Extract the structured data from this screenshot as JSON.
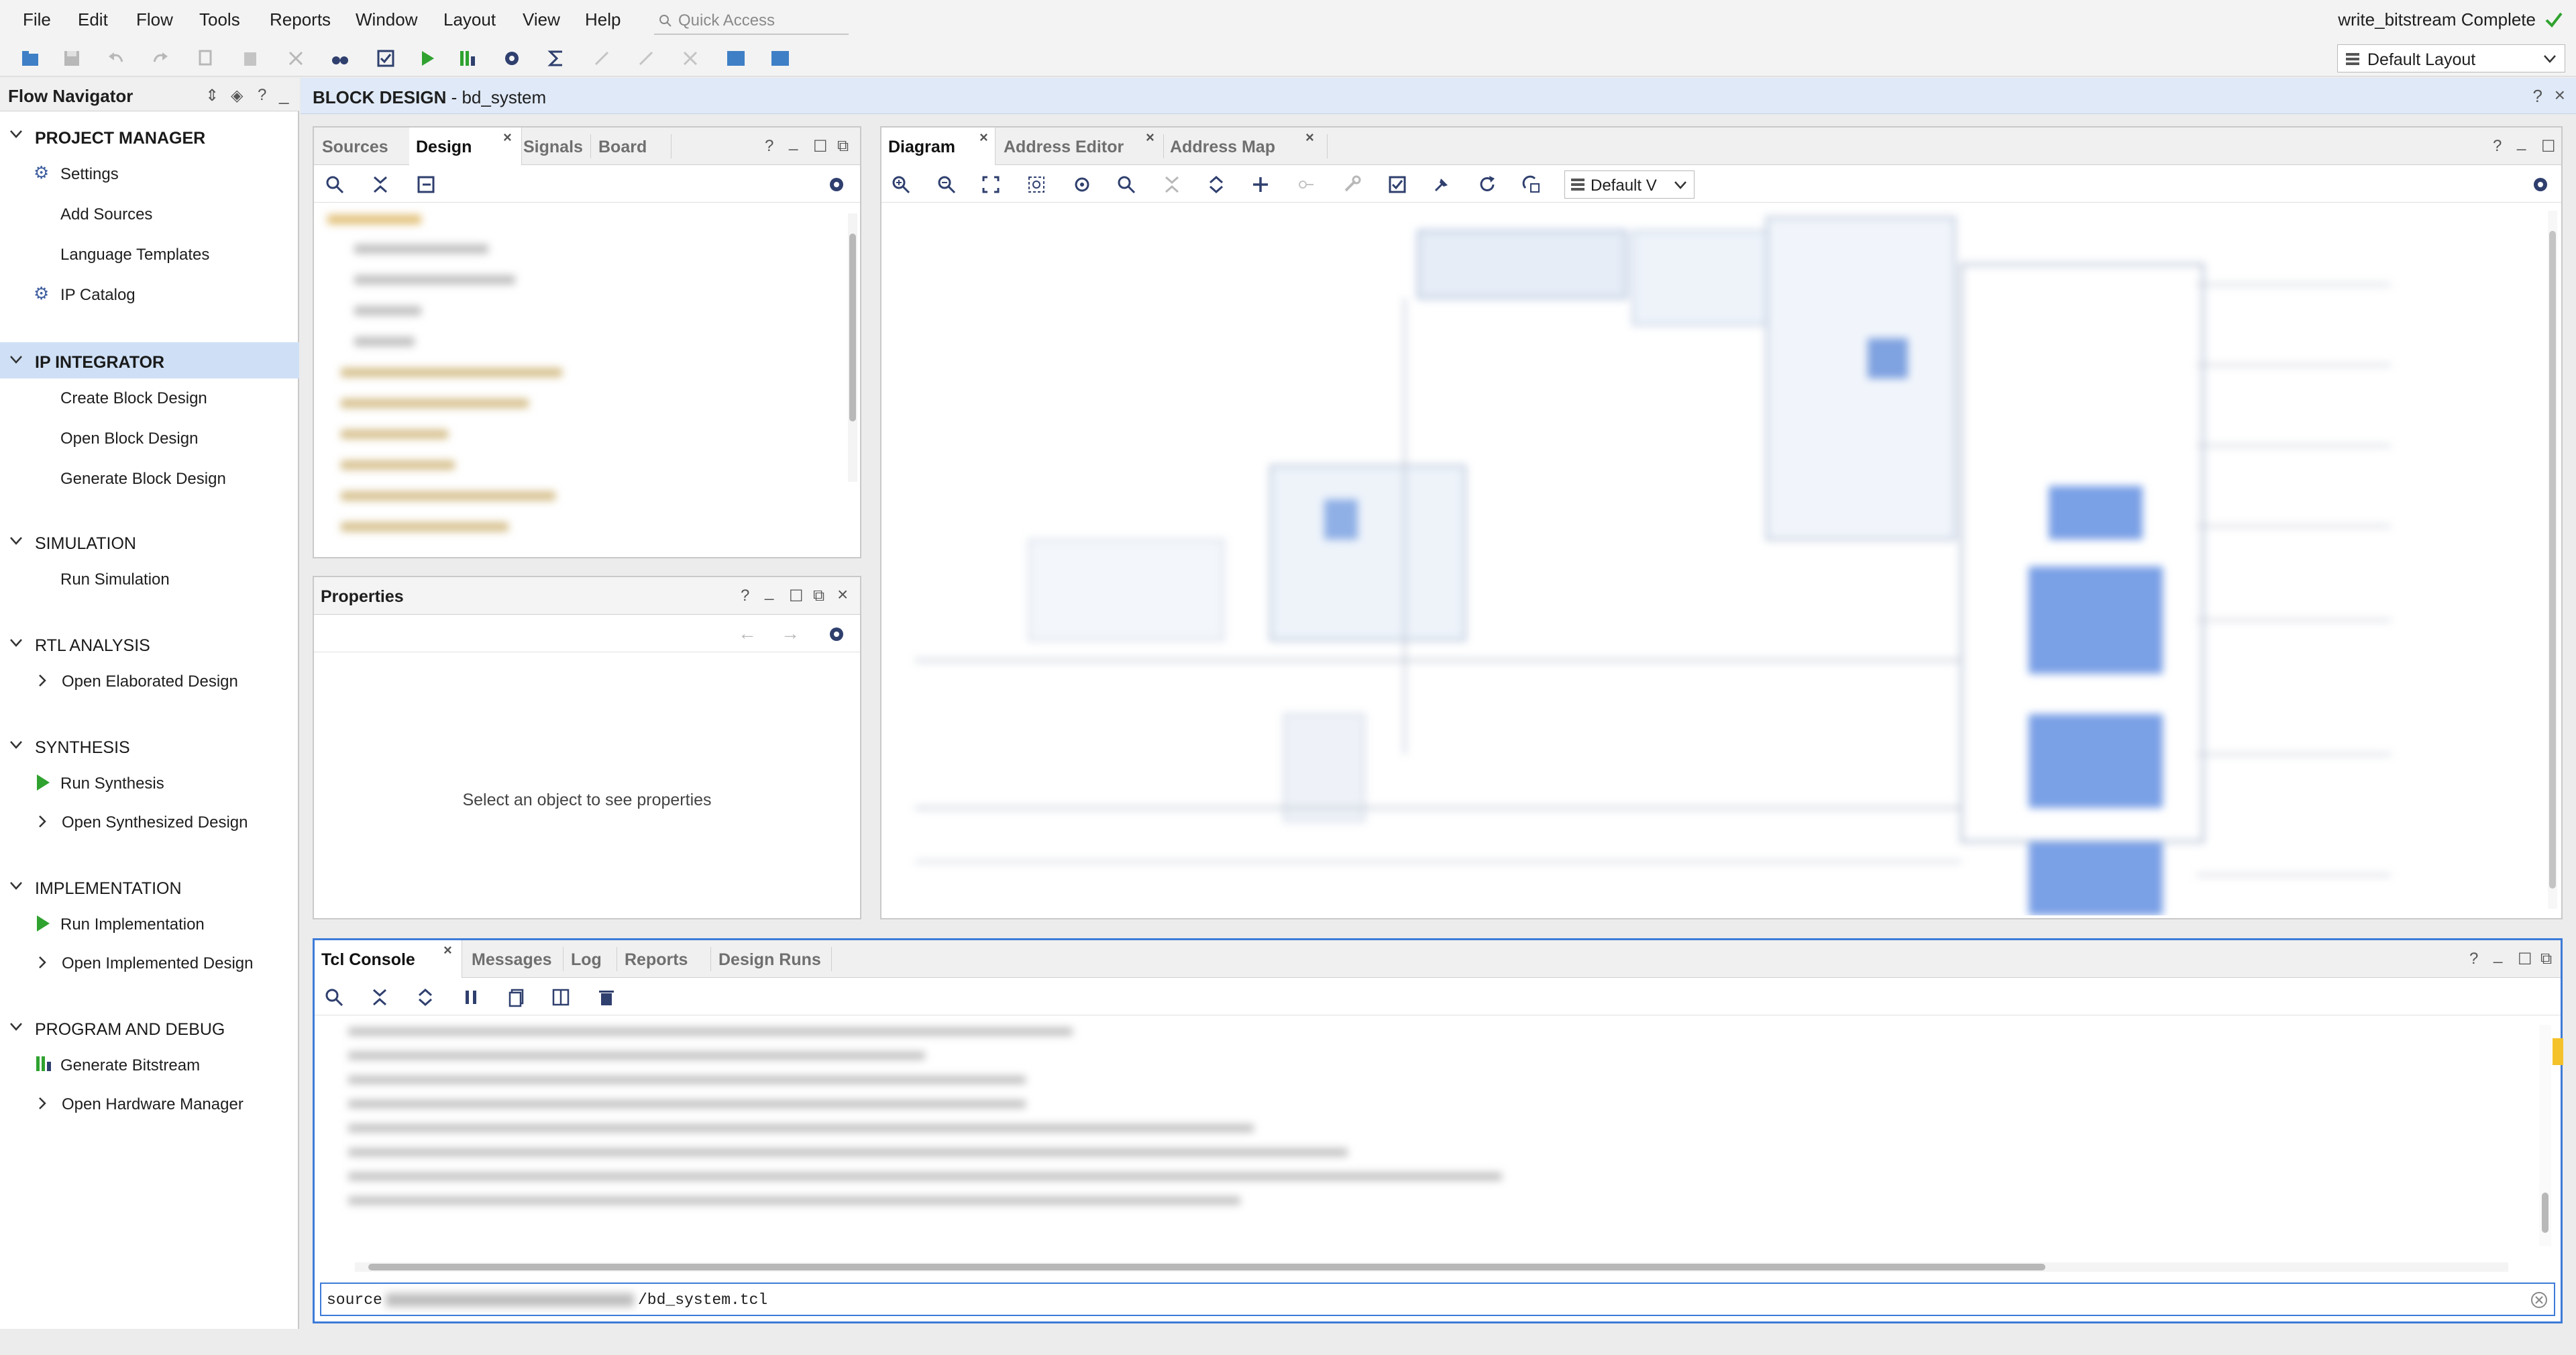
{
  "menu": {
    "items": [
      "File",
      "Edit",
      "Flow",
      "Tools",
      "Reports",
      "Window",
      "Layout",
      "View",
      "Help"
    ],
    "quick_access_placeholder": "Quick Access",
    "status": "write_bitstream Complete"
  },
  "toolbar": {
    "layout_label": "Default Layout"
  },
  "flow_navigator": {
    "title": "Flow Navigator",
    "sections": {
      "project_manager": "PROJECT MANAGER",
      "ip_integrator": "IP INTEGRATOR",
      "simulation": "SIMULATION",
      "rtl_analysis": "RTL ANALYSIS",
      "synthesis": "SYNTHESIS",
      "implementation": "IMPLEMENTATION",
      "program_debug": "PROGRAM AND DEBUG"
    },
    "items": {
      "settings": "Settings",
      "add_sources": "Add Sources",
      "language_templates": "Language Templates",
      "ip_catalog": "IP Catalog",
      "create_block_design": "Create Block Design",
      "open_block_design": "Open Block Design",
      "generate_block_design": "Generate Block Design",
      "run_simulation": "Run Simulation",
      "open_elaborated_design": "Open Elaborated Design",
      "run_synthesis": "Run Synthesis",
      "open_synthesized_design": "Open Synthesized Design",
      "run_implementation": "Run Implementation",
      "open_implemented_design": "Open Implemented Design",
      "generate_bitstream": "Generate Bitstream",
      "open_hardware_manager": "Open Hardware Manager"
    }
  },
  "block_design": {
    "title_prefix": "BLOCK DESIGN",
    "title_sep": " - ",
    "name": "bd_system"
  },
  "sources_panel": {
    "tabs": [
      "Sources",
      "Design",
      "Signals",
      "Board"
    ]
  },
  "properties_panel": {
    "title": "Properties",
    "empty_text": "Select an object to see properties"
  },
  "diagram_panel": {
    "tabs": [
      "Diagram",
      "Address Editor",
      "Address Map"
    ],
    "view_select": "Default V"
  },
  "console_panel": {
    "tabs": [
      "Tcl Console",
      "Messages",
      "Log",
      "Reports",
      "Design Runs"
    ],
    "input_prefix": "source",
    "input_suffix": "/bd_system.tcl"
  },
  "colors": {
    "accent_blue": "#3d7bd8",
    "run_green": "#2fa22f",
    "highlight": "#cfe0f6"
  }
}
